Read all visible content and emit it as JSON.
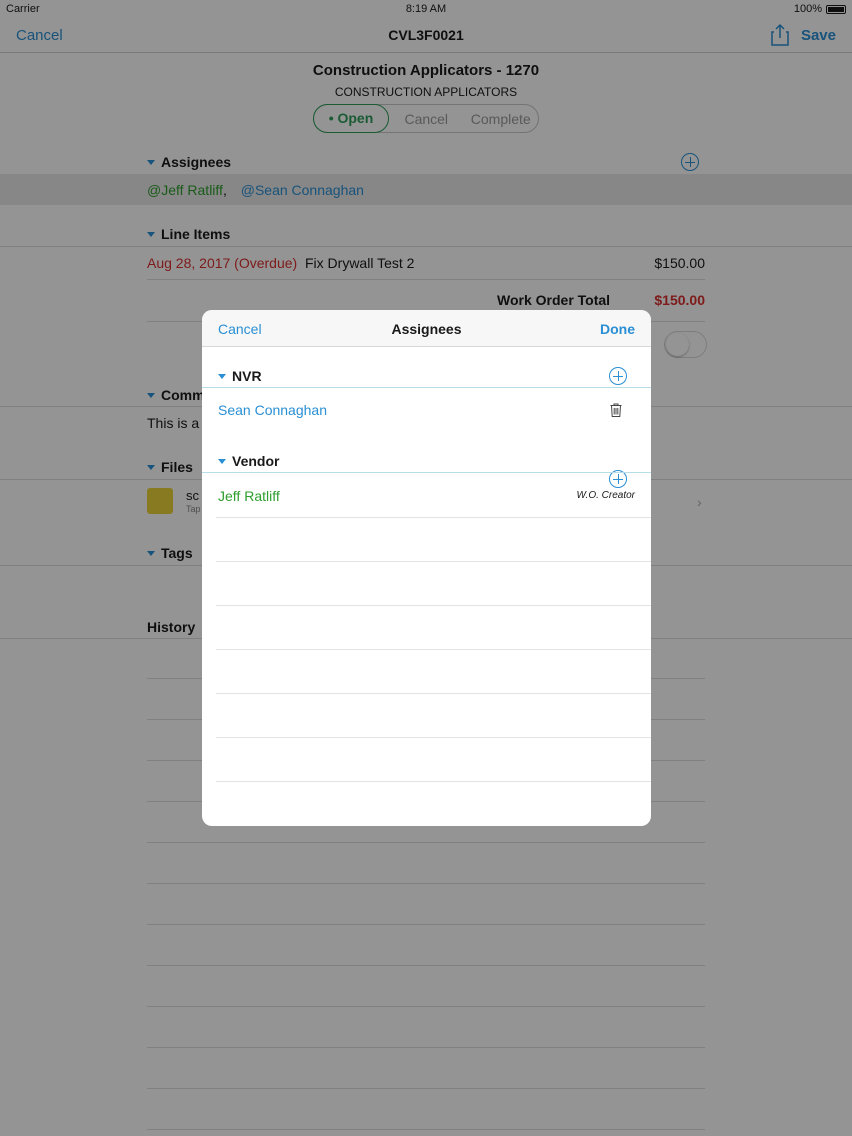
{
  "status_bar": {
    "carrier": "Carrier",
    "time": "8:19 AM",
    "battery": "100%"
  },
  "nav": {
    "cancel": "Cancel",
    "title": "CVL3F0021",
    "save": "Save"
  },
  "header": {
    "title": "Construction Applicators - 1270",
    "subtitle": "CONSTRUCTION APPLICATORS",
    "segments": [
      "• Open",
      "Cancel",
      "Complete"
    ]
  },
  "assignees": {
    "label": "Assignees",
    "people": [
      "@Jeff Ratliff",
      "@Sean Connaghan"
    ],
    "separator": ","
  },
  "line_items": {
    "label": "Line Items",
    "items": [
      {
        "date": "Aug 28, 2017 (Overdue)",
        "name": "Fix Drywall Test 2",
        "price": "$150.00"
      }
    ],
    "total_label": "Work Order Total",
    "total_value": "$150.00"
  },
  "comments": {
    "label": "Comm",
    "text": "This is a"
  },
  "files": {
    "label": "Files",
    "file_name": "sc",
    "file_hint": "Tap"
  },
  "tags": {
    "label": "Tags"
  },
  "history": {
    "label": "History"
  },
  "modal": {
    "cancel": "Cancel",
    "title": "Assignees",
    "done": "Done",
    "groups": [
      {
        "label": "NVR",
        "members": [
          {
            "name": "Sean Connaghan",
            "role": ""
          }
        ]
      },
      {
        "label": "Vendor",
        "members": [
          {
            "name": "Jeff Ratliff",
            "role": "W.O. Creator"
          }
        ]
      }
    ]
  },
  "colors": {
    "accent": "#2a8fd4",
    "open_green": "#2e9e5a",
    "overdue_red": "#d93030",
    "vendor_green": "#2e9e2e"
  }
}
